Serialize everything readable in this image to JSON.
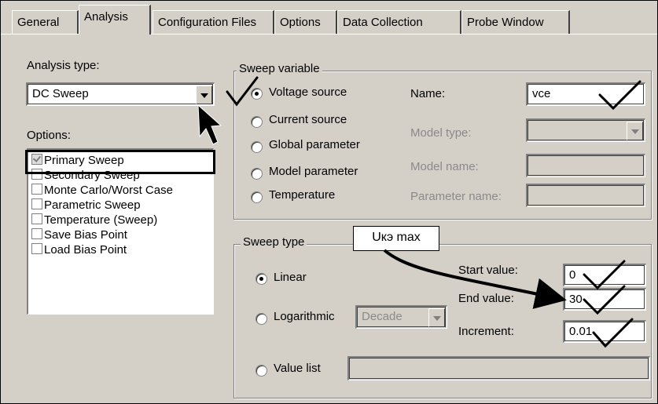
{
  "tabs": [
    "General",
    "Analysis",
    "Configuration Files",
    "Options",
    "Data Collection",
    "Probe Window"
  ],
  "analysis_type": {
    "label": "Analysis type:",
    "value": "DC Sweep"
  },
  "options": {
    "label": "Options:",
    "items": [
      {
        "label": "Primary Sweep",
        "checked": true
      },
      {
        "label": "Secondary Sweep",
        "checked": false
      },
      {
        "label": "Monte Carlo/Worst Case",
        "checked": false
      },
      {
        "label": "Parametric Sweep",
        "checked": false
      },
      {
        "label": "Temperature (Sweep)",
        "checked": false
      },
      {
        "label": "Save Bias Point",
        "checked": false
      },
      {
        "label": "Load Bias Point",
        "checked": false
      }
    ]
  },
  "sweep_variable": {
    "legend": "Sweep variable",
    "radios": [
      "Voltage source",
      "Current source",
      "Global parameter",
      "Model parameter",
      "Temperature"
    ],
    "selected": "Voltage source",
    "name_label": "Name:",
    "name_value": "vce",
    "model_type_label": "Model type:",
    "model_name_label": "Model name:",
    "parameter_name_label": "Parameter name:"
  },
  "sweep_type": {
    "legend": "Sweep type",
    "linear": "Linear",
    "logarithmic": "Logarithmic",
    "log_scale": "Decade",
    "value_list": "Value list",
    "selected": "Linear",
    "start_label": "Start value:",
    "start_value": "0",
    "end_label": "End value:",
    "end_value": "30",
    "increment_label": "Increment:",
    "increment_value": "0.01"
  },
  "annotation": {
    "text": "Uкэ max"
  }
}
